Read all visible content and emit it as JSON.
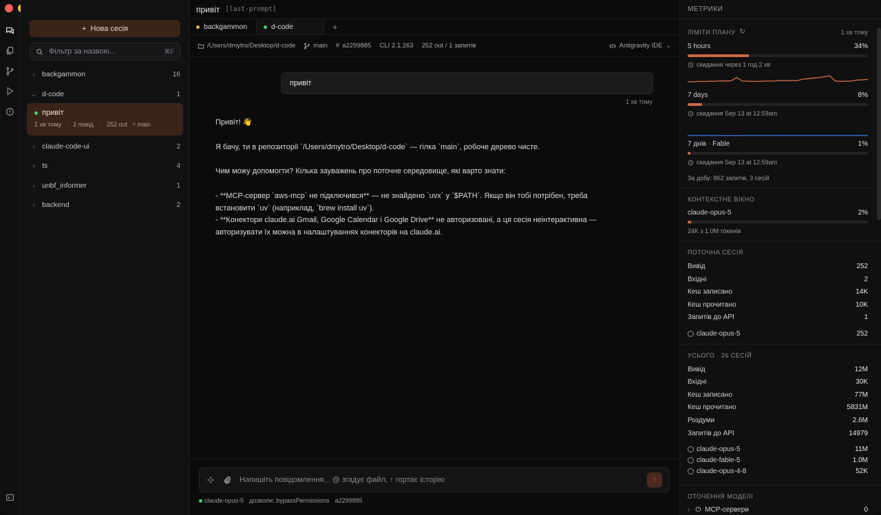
{
  "topbar": {
    "title": "привіт",
    "tag": "[last-prompt]"
  },
  "sidebar": {
    "new_session": "Нова сесія",
    "filter_placeholder": "Фільтр за назвою...",
    "filter_shortcut": "⌘F",
    "groups": [
      {
        "name": "backgammon",
        "count": "16",
        "expanded": false
      },
      {
        "name": "d-code",
        "count": "1",
        "expanded": true
      },
      {
        "name": "claude-code-ui",
        "count": "2",
        "expanded": false
      },
      {
        "name": "ts",
        "count": "4",
        "expanded": false
      },
      {
        "name": "unbf_informer",
        "count": "1",
        "expanded": false
      },
      {
        "name": "backend",
        "count": "2",
        "expanded": false
      }
    ],
    "active_session": {
      "title": "привіт",
      "time": "1 хв тому",
      "messages": "2 повід.",
      "out": "252 out",
      "branch": "main"
    }
  },
  "tabs": [
    {
      "label": "backgammon",
      "color": "#e0b341"
    },
    {
      "label": "d-code",
      "color": "#4ccf6a"
    }
  ],
  "infobar": {
    "path": "/Users/dmytro/Desktop/d-code",
    "branch": "main",
    "commit": "a2299885",
    "cli": "CLI 2.1.263",
    "stats": "252 out / 1 запитів",
    "ide": "Antigravity IDE"
  },
  "chat": {
    "user_message": "привіт",
    "user_time": "1 хв тому",
    "reply": [
      "Привіт! 👋",
      "",
      "Я бачу, ти в репозиторії `/Users/dmytro/Desktop/d-code` — гілка `main`, робоче дерево чисте.",
      "",
      "Чим можу допомогти? Кілька зауважень про поточне середовище, які варто знати:",
      "",
      "- **MCP-сервер `aws-mcp` не підключився** — не знайдено `uvx` у `$PATH`. Якщо він тобі потрібен, треба",
      "встановити `uv` (наприклад, `brew install uv`).",
      "- **Конектори claude.ai Gmail, Google Calendar і Google Drive** не авторизовані, а ця сесія неінтерактивна —",
      "авторизувати їх можна в налаштуваннях конекторів на claude.ai."
    ]
  },
  "composer": {
    "placeholder": "Напишіть повідомлення... @ згадує файл, ↑ гортає історію",
    "model": "claude-opus-5",
    "permissions": "дозволи: bypassPermissions",
    "commit": "a2299885"
  },
  "metrics": {
    "header": "МЕТРИКИ",
    "plan": {
      "title": "ЛІМІТИ ПЛАНУ",
      "updated": "1 хв тому",
      "limits": [
        {
          "label": "5 hours",
          "percent": "34%",
          "fraction": 0.34,
          "note": "скидання через 1 год 2 хв",
          "trend": [
            0.3,
            0.3,
            0.32,
            0.31,
            0.33,
            0.32,
            0.35,
            0.34,
            0.36,
            0.55,
            0.34,
            0.33,
            0.32,
            0.32,
            0.33,
            0.34,
            0.34,
            0.38,
            0.36,
            0.37,
            0.36,
            0.45,
            0.48,
            0.52,
            0.55,
            0.6,
            0.66,
            0.34,
            0.32,
            0.33,
            0.34,
            0.4,
            0.42,
            0.44
          ],
          "trend_color": "#c9694a"
        },
        {
          "label": "7 days",
          "percent": "8%",
          "fraction": 0.08,
          "note": "скидання Sep 13 at 12:59am",
          "trend": [
            0.08,
            0.08,
            0.08,
            0.075,
            0.07,
            0.07,
            0.075,
            0.075,
            0.075,
            0.075,
            0.08,
            0.08,
            0.08,
            0.08,
            0.08,
            0.08,
            0.08,
            0.08,
            0.08,
            0.085
          ],
          "trend_color": "#3b6fd6"
        },
        {
          "label": "7 днів · Fable",
          "percent": "1%",
          "fraction": 0.01,
          "note": "скидання Sep 13 at 12:59am"
        }
      ],
      "daily": "За добу: 862 запитів, 3 сесій"
    },
    "context": {
      "title": "КОНТЕКСТНЕ ВІКНО",
      "model": "claude-opus-5",
      "percent": "2%",
      "fraction": 0.02,
      "tokens": "24K з 1.0M токенів"
    },
    "current": {
      "title": "ПОТОЧНА СЕСІЯ",
      "rows": [
        {
          "label": "Вивід",
          "value": "252"
        },
        {
          "label": "Вхідні",
          "value": "2"
        },
        {
          "label": "Кеш записано",
          "value": "14K"
        },
        {
          "label": "Кеш прочитано",
          "value": "10K"
        },
        {
          "label": "Запитів до API",
          "value": "1"
        }
      ],
      "models": [
        {
          "label": "claude-opus-5",
          "value": "252"
        }
      ]
    },
    "total": {
      "title": "УСЬОГО · 26 СЕСІЙ",
      "rows": [
        {
          "label": "Вивід",
          "value": "12M"
        },
        {
          "label": "Вхідні",
          "value": "30K"
        },
        {
          "label": "Кеш записано",
          "value": "77M"
        },
        {
          "label": "Кеш прочитано",
          "value": "5831M"
        },
        {
          "label": "Роздуми",
          "value": "2.6M"
        },
        {
          "label": "Запитів до API",
          "value": "14979"
        }
      ],
      "models": [
        {
          "label": "claude-opus-5",
          "value": "11M"
        },
        {
          "label": "claude-fable-5",
          "value": "1.0M"
        },
        {
          "label": "claude-opus-4-8",
          "value": "52K"
        }
      ]
    },
    "env": {
      "title": "ОТОЧЕННЯ МОДЕЛІ",
      "mcp_label": "MCP-сервери",
      "mcp_count": "0"
    }
  }
}
